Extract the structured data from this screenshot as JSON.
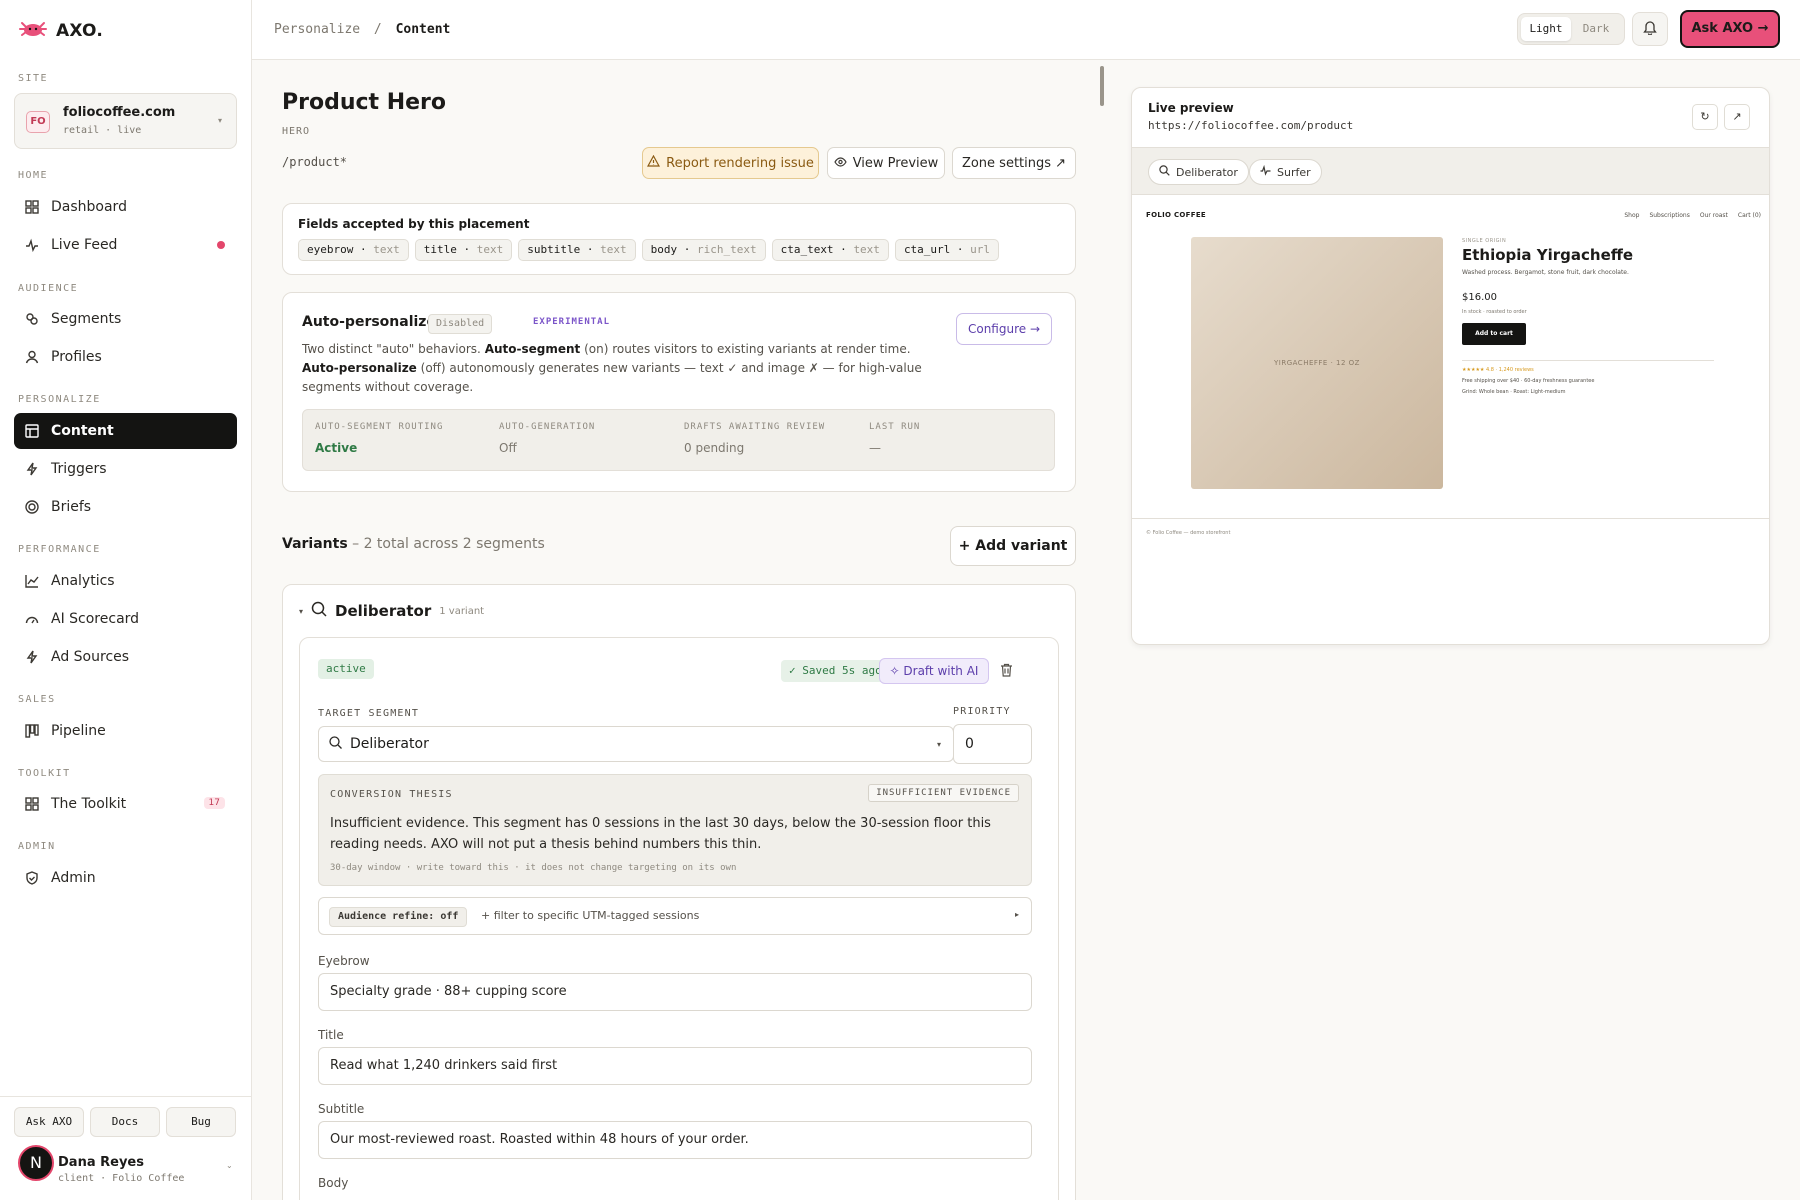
{
  "brand": {
    "name": "AXO."
  },
  "sidebar": {
    "site_label": "SITE",
    "site": {
      "badge": "FO",
      "name": "foliocoffee.com",
      "sub": "retail · live"
    },
    "sections": {
      "home": "HOME",
      "audience": "AUDIENCE",
      "personalize": "PERSONALIZE",
      "performance": "PERFORMANCE",
      "sales": "SALES",
      "toolkit": "TOOLKIT",
      "admin": "ADMIN"
    },
    "items": {
      "dashboard": "Dashboard",
      "live_feed": "Live Feed",
      "segments": "Segments",
      "profiles": "Profiles",
      "content": "Content",
      "triggers": "Triggers",
      "briefs": "Briefs",
      "analytics": "Analytics",
      "ai_scorecard": "AI Scorecard",
      "ad_sources": "Ad Sources",
      "pipeline": "Pipeline",
      "toolkit": "The Toolkit",
      "toolkit_count": "17",
      "admin": "Admin"
    },
    "footer": {
      "ask": "Ask AXO",
      "docs": "Docs",
      "bug": "Bug",
      "avatar": "N",
      "user_name": "Dana Reyes",
      "user_sub": "client · Folio Coffee"
    }
  },
  "topbar": {
    "crumb_parent": "Personalize",
    "crumb_sep": "/",
    "crumb_current": "Content",
    "theme_light": "Light",
    "theme_dark": "Dark",
    "ask_label": "Ask AXO →"
  },
  "main": {
    "title": "Product Hero",
    "tag": "HERO",
    "route": "/product*",
    "report_btn": "Report rendering issue",
    "view_preview_btn": "View Preview",
    "zone_settings_btn": "Zone settings ↗",
    "fields_title": "Fields accepted by this placement",
    "fields": [
      {
        "name": "eyebrow",
        "type": "text"
      },
      {
        "name": "title",
        "type": "text"
      },
      {
        "name": "subtitle",
        "type": "text"
      },
      {
        "name": "body",
        "type": "rich_text"
      },
      {
        "name": "cta_text",
        "type": "text"
      },
      {
        "name": "cta_url",
        "type": "url"
      }
    ],
    "auto": {
      "title": "Auto-personalize",
      "status": "Disabled",
      "flag": "EXPERIMENTAL",
      "configure": "Configure →",
      "desc_1": "Two distinct \"auto\" behaviors. ",
      "desc_2": "Auto-segment",
      "desc_3": " (on) routes visitors to existing variants at render time. ",
      "desc_4": "Auto-personalize",
      "desc_5": " (off) autonomously generates new variants — text ✓ and image ✗ — for high-value segments without coverage.",
      "stats": [
        {
          "label": "AUTO-SEGMENT ROUTING",
          "value": "Active"
        },
        {
          "label": "AUTO-GENERATION",
          "value": "Off"
        },
        {
          "label": "DRAFTS AWAITING REVIEW",
          "value": "0 pending"
        },
        {
          "label": "LAST RUN",
          "value": "—"
        }
      ]
    },
    "variants_label": "Variants",
    "variants_summary": " – 2 total across 2 segments",
    "add_variant": "+ Add variant",
    "segment": {
      "name": "Deliberator",
      "count": "1 variant"
    },
    "variant": {
      "status": "active",
      "saved": "✓ Saved 5s ago",
      "draft_ai": "Draft with AI",
      "target_label": "TARGET SEGMENT",
      "target_value": "Deliberator",
      "priority_label": "PRIORITY",
      "priority_value": "0",
      "thesis_label": "CONVERSION THESIS",
      "thesis_badge": "INSUFFICIENT EVIDENCE",
      "thesis_text": "Insufficient evidence. This segment has 0 sessions in the last 30 days, below the 30-session floor this reading needs. AXO will not put a thesis behind numbers this thin.",
      "thesis_note": "30-day window · write toward this · it does not change targeting on its own",
      "refine_pill": "Audience refine: off",
      "refine_text": "+ filter to specific UTM-tagged sessions",
      "eyebrow_label": "Eyebrow",
      "eyebrow_value": "Specialty grade · 88+ cupping score",
      "title_label": "Title",
      "title_value": "Read what 1,240 drinkers said first",
      "subtitle_label": "Subtitle",
      "subtitle_value": "Our most-reviewed roast. Roasted within 48 hours of your order.",
      "body_label": "Body"
    }
  },
  "preview": {
    "title": "Live preview",
    "url": "https://foliocoffee.com/product",
    "chips": [
      "Deliberator",
      "Surfer"
    ],
    "site": {
      "logo": "FOLIO COFFEE",
      "nav": [
        "Shop",
        "Subscriptions",
        "Our roast",
        "Cart (0)"
      ],
      "image_caption": "YIRGACHEFFE · 12 OZ",
      "kicker": "SINGLE ORIGIN",
      "product": "Ethiopia Yirgacheffe",
      "desc": "Washed process. Bergamot, stone fruit, dark chocolate.",
      "price": "$16.00",
      "stock": "In stock · roasted to order",
      "cart": "Add to cart",
      "reviews": "★★★★★ 4.8 · 1,240 reviews",
      "shipping": "Free shipping over $40 · 60-day freshness guarantee",
      "grind": "Grind: Whole bean · Roast: Light-medium",
      "footer": "© Folio Coffee — demo storefront"
    }
  }
}
